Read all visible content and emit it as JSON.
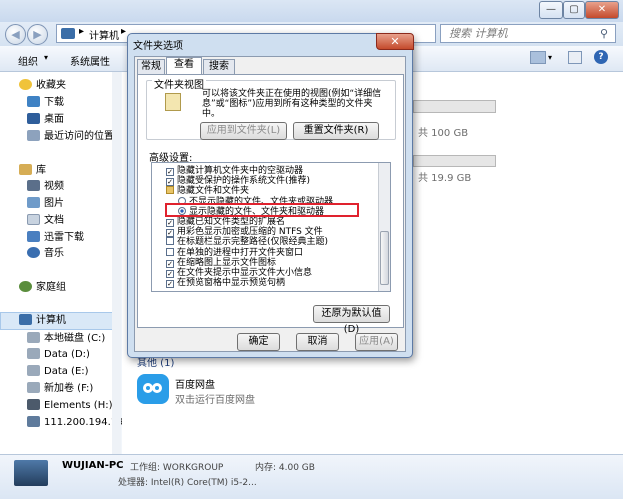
{
  "explorer": {
    "breadcrumb": "计算机",
    "search_placeholder": "搜索 计算机",
    "toolbar": {
      "organize": "组织",
      "properties": "系统属性"
    },
    "nav": {
      "favorites": "收藏夹",
      "downloads": "下载",
      "desktop": "桌面",
      "recent": "最近访问的位置",
      "libraries": "库",
      "videos": "视频",
      "pictures": "图片",
      "documents": "文档",
      "thunder": "迅雷下载",
      "music": "音乐",
      "homegroup": "家庭组",
      "computer": "计算机",
      "drive_c": "本地磁盘 (C:)",
      "drive_d": "Data (D:)",
      "drive_e": "Data (E:)",
      "drive_f": "新加卷 (F:)",
      "drive_h": "Elements (H:)",
      "network_drive": "111.200.194.19"
    },
    "content": {
      "drive_c_size": "共 100 GB",
      "drive_d_size": "共 19.9 GB",
      "section_label": "其他 (1)",
      "baidu_name": "百度网盘",
      "baidu_desc": "双击运行百度网盘"
    },
    "details": {
      "pc_name": "WUJIAN-PC",
      "workgroup": "工作组: WORKGROUP",
      "memory": "内存: 4.00 GB",
      "processor": "处理器: Intel(R) Core(TM) i5-2..."
    }
  },
  "dialog": {
    "title": "文件夹选项",
    "tabs": [
      "常规",
      "查看",
      "搜索"
    ],
    "folder_views_label": "文件夹视图",
    "folder_views_desc": "可以将该文件夹正在使用的视图(例如“详细信息”或“图标”)应用到所有这种类型的文件夹中。",
    "apply_to_folders": "应用到文件夹(L)",
    "reset_folders": "重置文件夹(R)",
    "advanced_label": "高级设置:",
    "advanced": [
      {
        "type": "checkbox",
        "checked": true,
        "indent": 1,
        "label": "隐藏计算机文件夹中的空驱动器"
      },
      {
        "type": "checkbox",
        "checked": true,
        "indent": 1,
        "label": "隐藏受保护的操作系统文件(推荐)"
      },
      {
        "type": "folder",
        "indent": 1,
        "label": "隐藏文件和文件夹"
      },
      {
        "type": "radio",
        "checked": false,
        "indent": 2,
        "label": "不显示隐藏的文件、文件夹或驱动器"
      },
      {
        "type": "radio",
        "checked": true,
        "indent": 2,
        "label": "显示隐藏的文件、文件夹和驱动器"
      },
      {
        "type": "checkbox",
        "checked": true,
        "indent": 1,
        "label": "隐藏已知文件类型的扩展名"
      },
      {
        "type": "checkbox",
        "checked": true,
        "indent": 1,
        "label": "用彩色显示加密或压缩的 NTFS 文件"
      },
      {
        "type": "checkbox",
        "checked": false,
        "indent": 1,
        "label": "在标题栏显示完整路径(仅限经典主题)"
      },
      {
        "type": "checkbox",
        "checked": false,
        "indent": 1,
        "label": "在单独的进程中打开文件夹窗口"
      },
      {
        "type": "checkbox",
        "checked": true,
        "indent": 1,
        "label": "在缩略图上显示文件图标"
      },
      {
        "type": "checkbox",
        "checked": true,
        "indent": 1,
        "label": "在文件夹提示中显示文件大小信息"
      },
      {
        "type": "checkbox",
        "checked": true,
        "indent": 1,
        "label": "在预览窗格中显示预览句柄"
      }
    ],
    "restore_defaults": "还原为默认值(D)",
    "ok": "确定",
    "cancel": "取消",
    "apply": "应用(A)"
  },
  "colors": {
    "highlight": "#e0222e",
    "bar_fill": "#26a0da"
  }
}
